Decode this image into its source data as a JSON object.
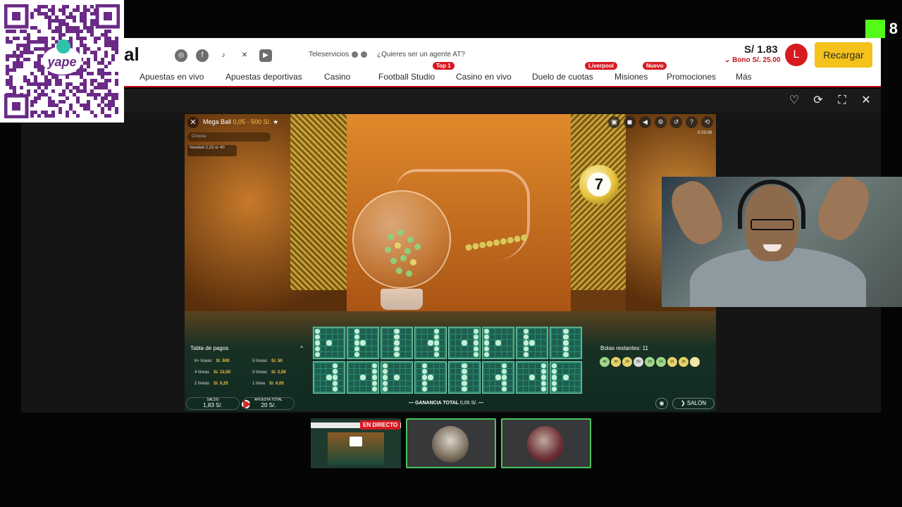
{
  "overlay": {
    "qr_label": "yape",
    "kick_count": "8"
  },
  "header": {
    "brand_fragment": "al",
    "social_icons": [
      "instagram-icon",
      "facebook-icon",
      "tiktok-icon",
      "x-icon",
      "youtube-icon"
    ],
    "teleservicios": "Teleservicios",
    "agent_question": "¿Quieres ser un agente AT?",
    "balance": "S/ 1.83",
    "bono": "Bono S/. 25.00",
    "avatar_initial": "L",
    "recargar": "Recargar",
    "nav": [
      {
        "label": "Apuestas en vivo"
      },
      {
        "label": "Apuestas deportivas"
      },
      {
        "label": "Casino"
      },
      {
        "label": "Football Studio",
        "tag": "Top 1"
      },
      {
        "label": "Casino en vivo"
      },
      {
        "label": "Duelo de cuotas",
        "tag": "Liverpool"
      },
      {
        "label": "Misiones",
        "tag": "Nuevo"
      },
      {
        "label": "Promociones"
      },
      {
        "label": "Más"
      }
    ]
  },
  "frame_controls": [
    "heart-icon",
    "refresh-icon",
    "fullscreen-icon",
    "close-icon"
  ],
  "game": {
    "name": "Mega Ball",
    "range": "0,05 - 500 S/.",
    "chooser_placeholder": "Choose",
    "needed": "Needed 2,23 or 40",
    "timer": "0:23:08",
    "drawn_ball": "7",
    "paytable": {
      "title": "Tabla de pagos",
      "rows": [
        {
          "lines": "6+ líneas",
          "pay": "S/. 500"
        },
        {
          "lines": "5 líneas",
          "pay": "S/. 50"
        },
        {
          "lines": "4 líneas",
          "pay": "S/. 12,50"
        },
        {
          "lines": "3 líneas",
          "pay": "S/. 2,50"
        },
        {
          "lines": "2 líneas",
          "pay": "S/. 0,25"
        },
        {
          "lines": "1 línea",
          "pay": "S/. 0,05"
        }
      ]
    },
    "remaining_label": "Bolas restantes: 11",
    "remaining_balls": [
      "46",
      "30",
      "29",
      "50",
      "18",
      "10",
      "31",
      "39",
      ""
    ],
    "saldo_label": "SALDO",
    "saldo_value": "1,83 S/.",
    "apuesta_label": "APUESTA TOTAL",
    "apuesta_value": "20 S/.",
    "ganancia_label": "GANANCIA TOTAL",
    "ganancia_value": "0,05 S/.",
    "salon": "SALÓN"
  },
  "thumbnails": {
    "live_badge": "EN DIRECTO"
  }
}
